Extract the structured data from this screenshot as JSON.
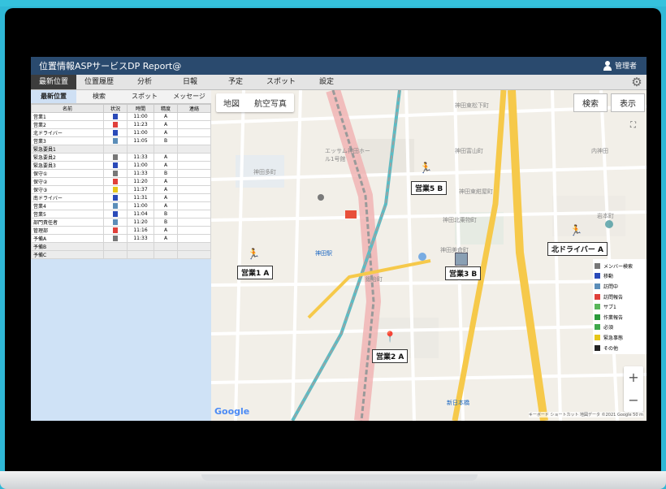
{
  "app": {
    "title": "位置情報ASPサービスDP Report@",
    "user": "管理者"
  },
  "menu": [
    "最新位置",
    "位置履歴",
    "分析",
    "日報",
    "予定",
    "スポット",
    "設定"
  ],
  "subtabs": [
    "最新位置",
    "検索",
    "スポット",
    "メッセージ"
  ],
  "table": {
    "headers": [
      "名前",
      "状況",
      "時間",
      "精度",
      "連絡"
    ],
    "rows": [
      {
        "name": "営業1",
        "status": "移動",
        "time": "11:00",
        "acc": "A"
      },
      {
        "name": "営業2",
        "status": "訪問報告",
        "time": "11:23",
        "acc": "A"
      },
      {
        "name": "北ドライバー",
        "status": "移動",
        "time": "11:00",
        "acc": "A"
      },
      {
        "name": "営業3",
        "status": "訪問中",
        "time": "11:05",
        "acc": "B"
      },
      {
        "name": "緊急要員1",
        "status": "",
        "time": "",
        "acc": "",
        "group": true
      },
      {
        "name": "緊急要員2",
        "status": "メンバー検索",
        "time": "11:33",
        "acc": "A"
      },
      {
        "name": "緊急要員3",
        "status": "移動",
        "time": "11:00",
        "acc": "A"
      },
      {
        "name": "保守①",
        "status": "メンバー検索",
        "time": "11:33",
        "acc": "B"
      },
      {
        "name": "保守②",
        "status": "訪問報告",
        "time": "11:20",
        "acc": "A"
      },
      {
        "name": "保守③",
        "status": "緊急事態",
        "time": "11:37",
        "acc": "A"
      },
      {
        "name": "南ドライバー",
        "status": "移動",
        "time": "11:31",
        "acc": "A"
      },
      {
        "name": "営業4",
        "status": "訪問中",
        "time": "11:00",
        "acc": "A"
      },
      {
        "name": "営業5",
        "status": "移動",
        "time": "11:04",
        "acc": "B"
      },
      {
        "name": "部門責任者",
        "status": "訪問中",
        "time": "11:20",
        "acc": "B"
      },
      {
        "name": "管理部",
        "status": "訪問報告",
        "time": "11:16",
        "acc": "A"
      },
      {
        "name": "予備A",
        "status": "メンバー検索",
        "time": "11:33",
        "acc": "A"
      },
      {
        "name": "予備B",
        "status": "",
        "time": "",
        "acc": "",
        "group": true
      },
      {
        "name": "予備C",
        "status": "",
        "time": "",
        "acc": "",
        "group": true
      }
    ]
  },
  "map": {
    "view_tabs": [
      "地図",
      "航空写真"
    ],
    "buttons": {
      "search": "検索",
      "display": "表示"
    },
    "labels": [
      "営業5 B",
      "営業1 A",
      "営業3 B",
      "営業2 A",
      "北ドライバー A"
    ],
    "place_names": [
      "神田東松下町",
      "神田多町",
      "神田富山町",
      "神田北乗物町",
      "エッサム神田ホール1号館",
      "神田駅",
      "神田美倉町",
      "神田東紺屋町",
      "鍛冶町",
      "新日本橋",
      "内神田",
      "岩本町"
    ],
    "google": "Google",
    "attribution": "キーボード ショートカット  地図データ ©2021 Google  50 m",
    "zoom": [
      "+",
      "−"
    ]
  },
  "legend": [
    {
      "label": "メンバー検索",
      "color": "#777777"
    },
    {
      "label": "移動",
      "color": "#2a4ab8"
    },
    {
      "label": "訪問中",
      "color": "#5b8db8"
    },
    {
      "label": "訪問報告",
      "color": "#e0403a"
    },
    {
      "label": "サブ1",
      "color": "#59b659"
    },
    {
      "label": "作業報告",
      "color": "#2a9a3a"
    },
    {
      "label": "必須",
      "color": "#3fa84a"
    },
    {
      "label": "緊急事態",
      "color": "#e6c619"
    },
    {
      "label": "その他",
      "color": "#222222"
    }
  ],
  "colors": {
    "header": "#2a4a6e",
    "menu_active": "#3c3c3c",
    "panel": "#cfe2f6"
  }
}
